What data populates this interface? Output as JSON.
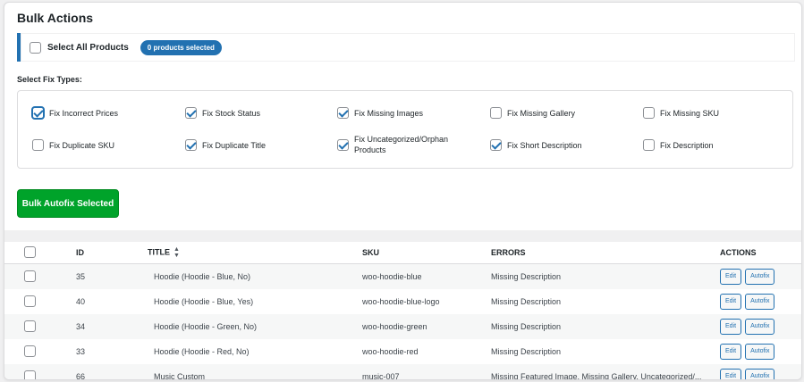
{
  "panel": {
    "title": "Bulk Actions"
  },
  "select_all": {
    "label": "Select All Products",
    "count_badge": "0 products selected"
  },
  "fix_types": {
    "heading": "Select Fix Types:",
    "items": [
      {
        "label": "Fix Incorrect Prices",
        "checked": true
      },
      {
        "label": "Fix Stock Status",
        "checked": true
      },
      {
        "label": "Fix Missing Images",
        "checked": true
      },
      {
        "label": "Fix Missing Gallery",
        "checked": false
      },
      {
        "label": "Fix Missing SKU",
        "checked": false
      },
      {
        "label": "Fix Duplicate SKU",
        "checked": false
      },
      {
        "label": "Fix Duplicate Title",
        "checked": true
      },
      {
        "label": "Fix Uncategorized/Orphan Products",
        "checked": true
      },
      {
        "label": "Fix Short Description",
        "checked": true
      },
      {
        "label": "Fix Description",
        "checked": false
      }
    ]
  },
  "autofix_button": {
    "label": "Bulk Autofix Selected"
  },
  "table": {
    "headers": {
      "id": "ID",
      "title": "TITLE",
      "sku": "SKU",
      "errors": "ERRORS",
      "actions": "ACTIONS"
    },
    "rows": [
      {
        "id": "35",
        "title": "Hoodie (Hoodie - Blue, No)",
        "sku": "woo-hoodie-blue",
        "errors": "Missing Description"
      },
      {
        "id": "40",
        "title": "Hoodie (Hoodie - Blue, Yes)",
        "sku": "woo-hoodie-blue-logo",
        "errors": "Missing Description"
      },
      {
        "id": "34",
        "title": "Hoodie (Hoodie - Green, No)",
        "sku": "woo-hoodie-green",
        "errors": "Missing Description"
      },
      {
        "id": "33",
        "title": "Hoodie (Hoodie - Red, No)",
        "sku": "woo-hoodie-red",
        "errors": "Missing Description"
      },
      {
        "id": "66",
        "title": "Music Custom",
        "sku": "music-007",
        "errors": "Missing Featured Image, Missing Gallery, Uncategorized/..."
      }
    ],
    "edit_label": "Edit",
    "autofix_label": "Autofix"
  }
}
